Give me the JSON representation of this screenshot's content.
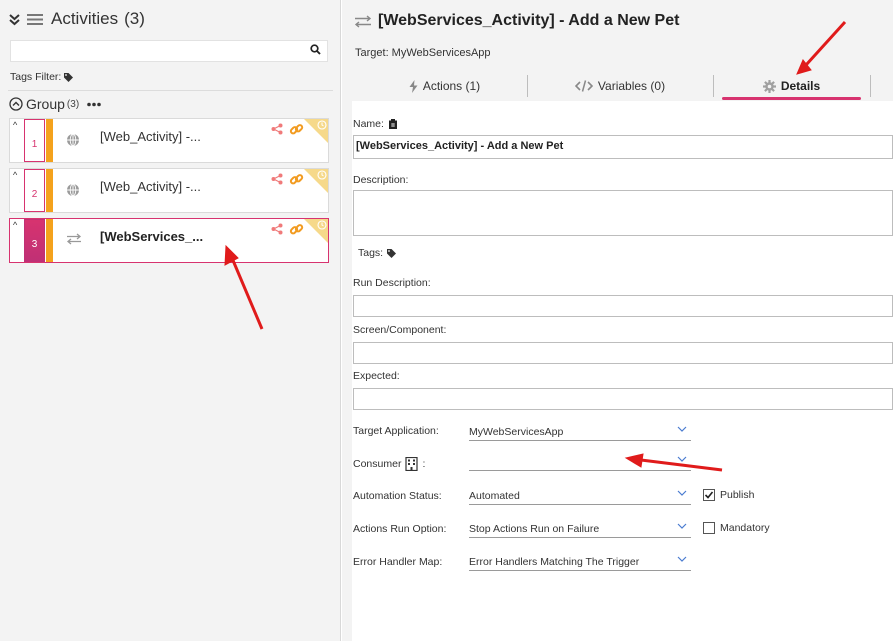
{
  "left_panel": {
    "title": "Activities",
    "count": "(3)",
    "search": {
      "value": "",
      "placeholder": ""
    },
    "tags_filter_label": "Tags Filter:",
    "group": {
      "name": "Group",
      "count": "(3)"
    },
    "activities": [
      {
        "number": "1",
        "name": "[Web_Activity] -...",
        "type_icon": "globe-icon",
        "selected": false
      },
      {
        "number": "2",
        "name": "[Web_Activity] -...",
        "type_icon": "globe-icon",
        "selected": false
      },
      {
        "number": "3",
        "name": "[WebServices_...",
        "type_icon": "exchange-arrows-icon",
        "selected": true
      }
    ]
  },
  "right_panel": {
    "title": "[WebServices_Activity] - Add a New Pet",
    "target": "Target: MyWebServicesApp",
    "tabs": [
      {
        "label": "Actions (1)",
        "icon": "bolt-icon",
        "active": false
      },
      {
        "label": "Variables (0)",
        "icon": "code-icon",
        "active": false
      },
      {
        "label": "Details",
        "icon": "gear-icon",
        "active": true
      }
    ],
    "details": {
      "name_label": "Name:",
      "name_value": "[WebServices_Activity] - Add a New Pet",
      "description_label": "Description:",
      "description_value": "",
      "tags_label": "Tags:",
      "run_description_label": "Run Description:",
      "run_description_value": "",
      "screen_component_label": "Screen/Component:",
      "screen_component_value": "",
      "expected_label": "Expected:",
      "expected_value": "",
      "target_application_label": "Target Application:",
      "target_application_value": "MyWebServicesApp",
      "consumer_label": "Consumer",
      "consumer_value": "",
      "automation_status_label": "Automation Status:",
      "automation_status_value": "Automated",
      "publish_label": "Publish",
      "publish_checked": true,
      "actions_run_option_label": "Actions Run Option:",
      "actions_run_option_value": "Stop Actions Run on Failure",
      "mandatory_label": "Mandatory",
      "mandatory_checked": false,
      "error_handler_map_label": "Error Handler Map:",
      "error_handler_map_value": "Error Handlers Matching The Trigger"
    }
  },
  "colors": {
    "accent": "#d7336f",
    "activity_bar": "#f4a21d",
    "annotation_arrow": "#e01b1b",
    "link_icon": "#f29b20",
    "share_icon": "#f07a7a"
  }
}
